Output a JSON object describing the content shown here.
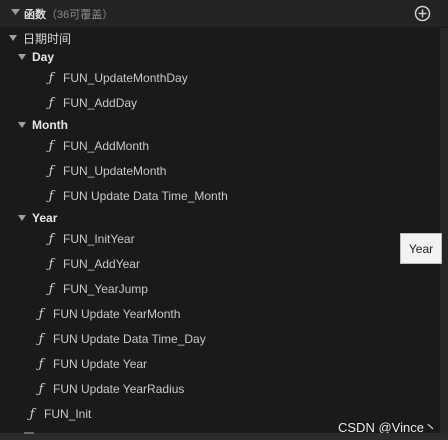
{
  "header": {
    "title": "函数",
    "count": "（36可覆盖）",
    "add_icon": "plus-circle-icon"
  },
  "tree": {
    "root_label": "日期时间",
    "day": {
      "label": "Day",
      "items": [
        "FUN_UpdateMonthDay",
        "FUN_AddDay"
      ]
    },
    "month": {
      "label": "Month",
      "items": [
        "FUN_AddMonth",
        "FUN_UpdateMonth",
        "FUN Update Data Time_Month"
      ]
    },
    "year": {
      "label": "Year",
      "items": [
        "FUN_InitYear",
        "FUN_AddYear",
        "FUN_YearJump"
      ]
    },
    "root_items": [
      "FUN Update YearMonth",
      "FUN Update Data Time_Day",
      "FUN Update Year",
      "FUN Update YearRadius"
    ],
    "top_items": [
      "FUN_Init"
    ]
  },
  "tooltip": {
    "text": "Year"
  },
  "watermark": "CSDN @Vince丶",
  "colors": {
    "background": "#1a1a1a",
    "header": "#232323",
    "text": "#c9c9c9",
    "tooltip_bg": "#f2f2f2"
  }
}
